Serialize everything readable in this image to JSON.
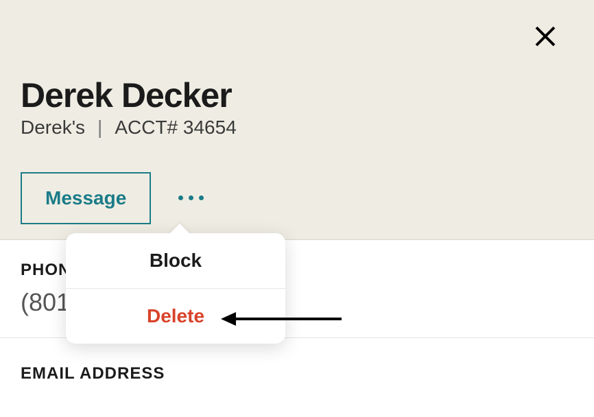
{
  "header": {
    "contact_name": "Derek Decker",
    "contact_group": "Derek's",
    "account_label": "ACCT# 34654"
  },
  "actions": {
    "message_label": "Message"
  },
  "popover": {
    "block_label": "Block",
    "delete_label": "Delete"
  },
  "sections": {
    "phone_label": "PHONE NUMBER",
    "phone_value": "(801) 555-5555",
    "email_label": "EMAIL ADDRESS"
  }
}
